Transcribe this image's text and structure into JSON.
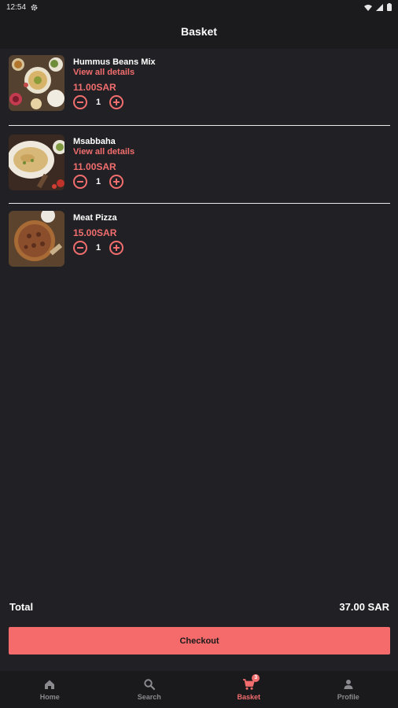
{
  "status_bar": {
    "time": "12:54",
    "icons": [
      "gear-icon",
      "wifi-icon",
      "signal-icon",
      "battery-icon"
    ]
  },
  "header": {
    "title": "Basket"
  },
  "items": [
    {
      "name": "Hummus Beans Mix",
      "details_link": "View all details",
      "price": "11.00SAR",
      "quantity": "1"
    },
    {
      "name": "Msabbaha",
      "details_link": "View all details",
      "price": "11.00SAR",
      "quantity": "1"
    },
    {
      "name": "Meat Pizza",
      "price": "15.00SAR",
      "quantity": "1"
    }
  ],
  "summary": {
    "total_label": "Total",
    "total_value": "37.00 SAR"
  },
  "checkout": {
    "label": "Checkout"
  },
  "nav": {
    "items": [
      {
        "label": "Home",
        "icon": "home-icon"
      },
      {
        "label": "Search",
        "icon": "search-icon"
      },
      {
        "label": "Basket",
        "icon": "cart-icon",
        "badge": "3"
      },
      {
        "label": "Profile",
        "icon": "person-icon"
      }
    ],
    "active": "Basket"
  },
  "colors": {
    "accent": "#f26d6d",
    "background": "#212125",
    "bar": "#1b1b1e"
  }
}
